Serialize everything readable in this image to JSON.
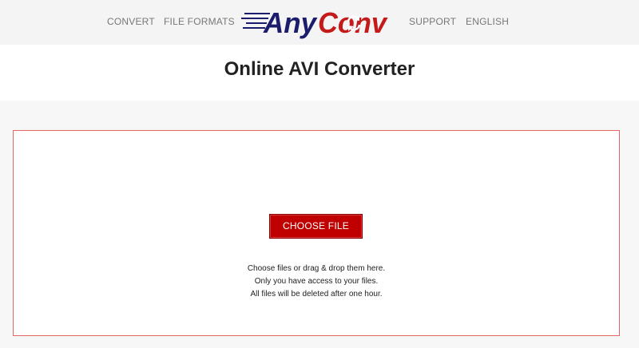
{
  "nav": {
    "convert": "CONVERT",
    "file_formats": "FILE FORMATS",
    "support": "SUPPORT",
    "language": "ENGLISH"
  },
  "logo": {
    "text_any": "Any",
    "text_conv": "Conv",
    "icon": "refresh-arrows-icon",
    "colors": {
      "navy": "#1c1c6c",
      "red": "#c41a1a"
    }
  },
  "page": {
    "title": "Online AVI Converter"
  },
  "upload": {
    "button_label": "CHOOSE FILE",
    "note_line_1": "Choose files or drag & drop them here.",
    "note_line_2": "Only you have access to your files.",
    "note_line_3": "All files will be deleted after one hour.",
    "colors": {
      "button": "#c00000",
      "border": "#e06666"
    }
  }
}
